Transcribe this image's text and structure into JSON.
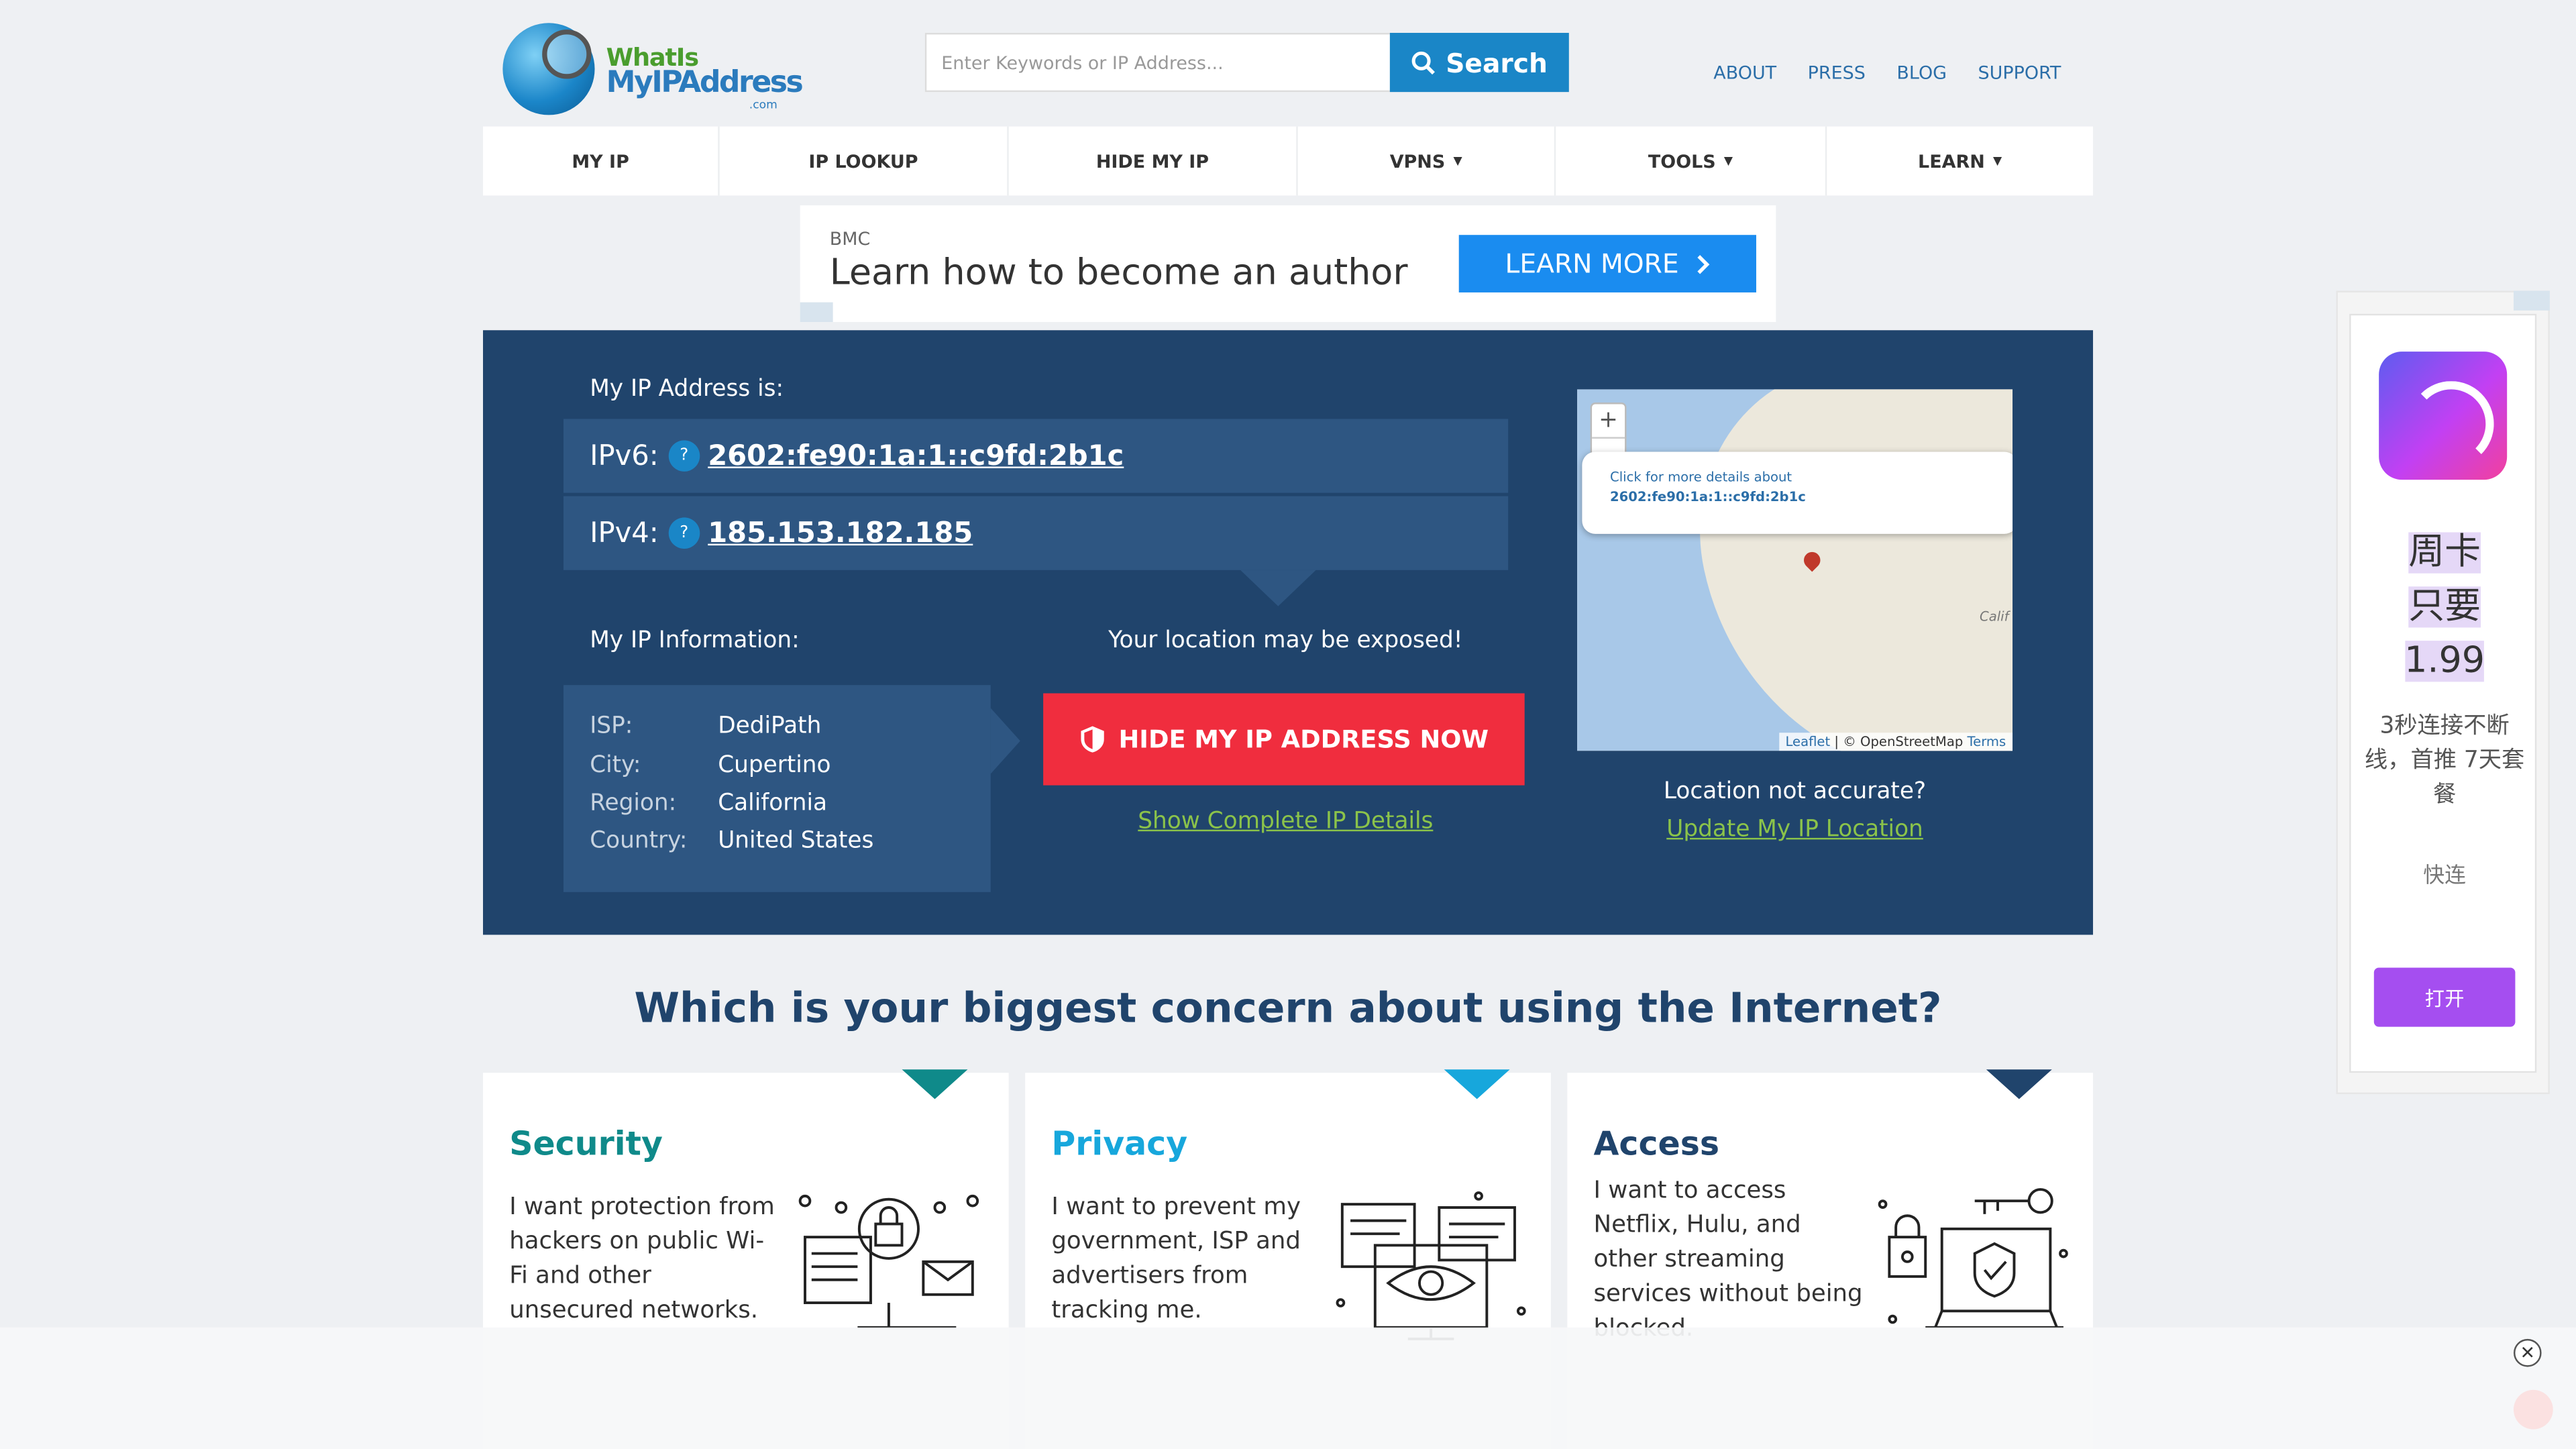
{
  "header": {
    "logo_line1": "WhatIs",
    "logo_line2": "MyIPAddress",
    "logo_suffix": ".com",
    "search_placeholder": "Enter Keywords or IP Address...",
    "search_button": "Search",
    "top_links": [
      "ABOUT",
      "PRESS",
      "BLOG",
      "SUPPORT"
    ]
  },
  "nav": {
    "items": [
      {
        "label": "MY IP",
        "dropdown": false
      },
      {
        "label": "IP LOOKUP",
        "dropdown": false
      },
      {
        "label": "HIDE MY IP",
        "dropdown": false
      },
      {
        "label": "VPNS",
        "dropdown": true
      },
      {
        "label": "TOOLS",
        "dropdown": true
      },
      {
        "label": "LEARN",
        "dropdown": true
      }
    ],
    "caret": "▼"
  },
  "ad_banner": {
    "brand": "BMC",
    "headline": "Learn how to become an author",
    "cta": "LEARN MORE"
  },
  "hero": {
    "my_ip_label": "My IP Address is:",
    "ipv6_label": "IPv6:",
    "ipv6_value": "2602:fe90:1a:1::c9fd:2b1c",
    "ipv4_label": "IPv4:",
    "ipv4_value": "185.153.182.185",
    "help_glyph": "?",
    "info_label": "My IP Information:",
    "info": {
      "isp_key": "ISP:",
      "isp": "DediPath",
      "city_key": "City:",
      "city": "Cupertino",
      "region_key": "Region:",
      "region": "California",
      "country_key": "Country:",
      "country": "United States"
    },
    "exposed_text": "Your location may be exposed!",
    "hide_button": "HIDE MY IP ADDRESS NOW",
    "show_details": "Show Complete IP Details",
    "map": {
      "zoom_in": "+",
      "zoom_out": "-",
      "popup_line1": "Click for more details about",
      "popup_line2": "2602:fe90:1a:1::c9fd:2b1c",
      "region_text": "Calif",
      "attrib_leaflet": "Leaflet",
      "attrib_osm": "© OpenStreetMap",
      "attrib_terms": "Terms"
    },
    "location_question": "Location not accurate?",
    "update_location": "Update My IP Location"
  },
  "concern": {
    "title": "Which is your biggest concern about using the Internet?",
    "cards": [
      {
        "title": "Security",
        "color": "#0f8a8a",
        "body": "I want protection from hackers on public Wi-Fi and other unsecured networks."
      },
      {
        "title": "Privacy",
        "color": "#17a7dc",
        "body": "I want to prevent my government, ISP and advertisers from tracking me."
      },
      {
        "title": "Access",
        "color": "#20446c",
        "body": "I want to access Netflix, Hulu, and other streaming services without being blocked."
      }
    ]
  },
  "side_ad": {
    "promo_lines": [
      "周卡",
      "只要",
      "1.99"
    ],
    "description": "3秒连接不断线，首推 7天套餐",
    "fast": "快连",
    "open_button": "打开"
  },
  "overlay": {
    "close_glyph": "✕"
  },
  "colors": {
    "hero_bg": "#20446c",
    "panel_bg": "#2e5682",
    "accent_blue": "#1a86c7",
    "hide_red": "#f02d3e",
    "link_green": "#8bc34a"
  }
}
